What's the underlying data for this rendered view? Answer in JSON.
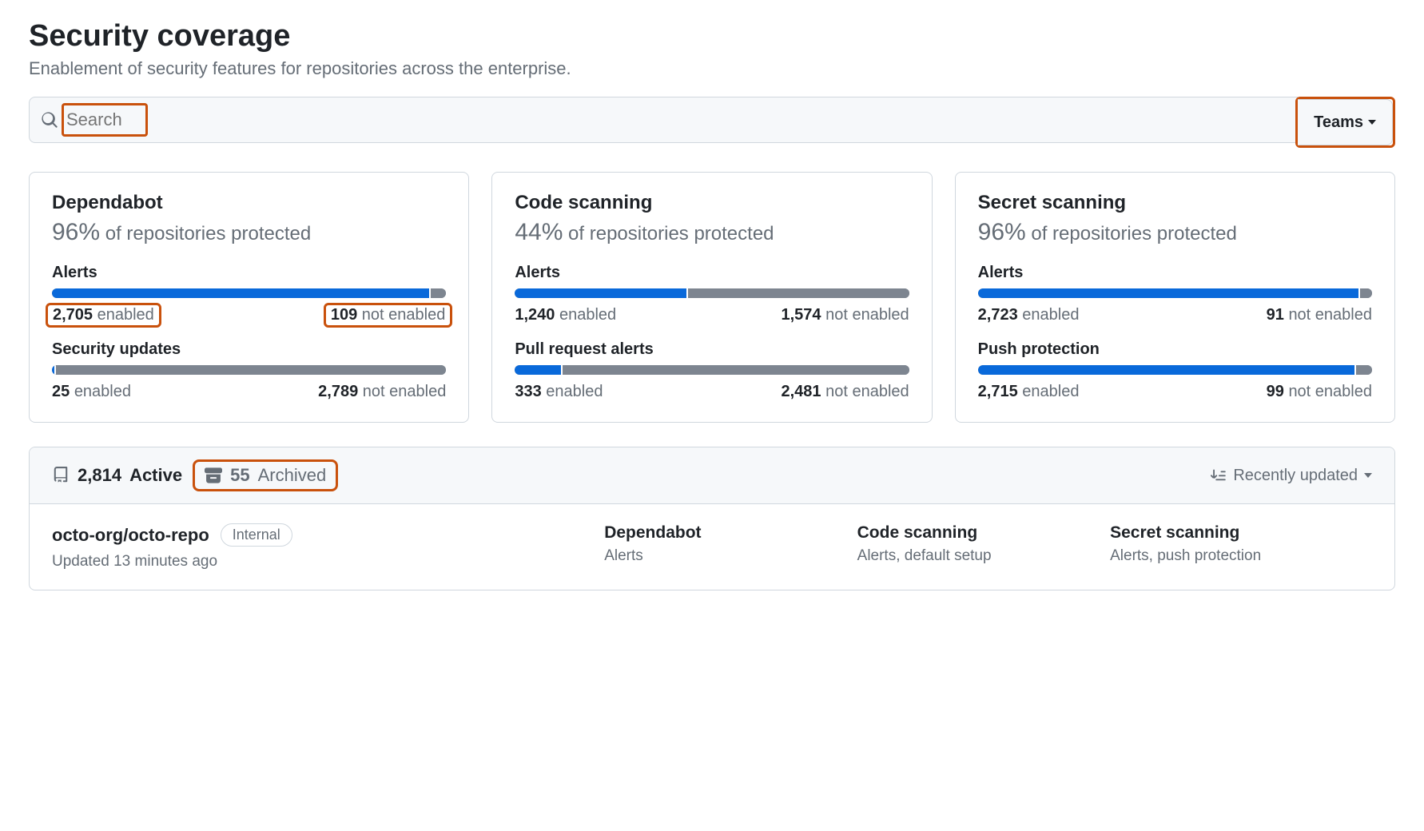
{
  "header": {
    "title": "Security coverage",
    "subtitle": "Enablement of security features for repositories across the enterprise."
  },
  "search": {
    "placeholder": "Search"
  },
  "teams_button": "Teams",
  "cards": {
    "dependabot": {
      "title": "Dependabot",
      "pct": "96%",
      "pct_suffix": "of repositories protected",
      "alerts_label": "Alerts",
      "alerts_enabled": "2,705",
      "alerts_not_enabled": "109",
      "alerts_fill_pct": 96,
      "sec_label": "Security updates",
      "sec_enabled": "25",
      "sec_not_enabled": "2,789",
      "sec_fill_pct": 1
    },
    "code": {
      "title": "Code scanning",
      "pct": "44%",
      "pct_suffix": "of repositories protected",
      "alerts_label": "Alerts",
      "alerts_enabled": "1,240",
      "alerts_not_enabled": "1,574",
      "alerts_fill_pct": 44,
      "pr_label": "Pull request alerts",
      "pr_enabled": "333",
      "pr_not_enabled": "2,481",
      "pr_fill_pct": 12
    },
    "secret": {
      "title": "Secret scanning",
      "pct": "96%",
      "pct_suffix": "of repositories protected",
      "alerts_label": "Alerts",
      "alerts_enabled": "2,723",
      "alerts_not_enabled": "91",
      "alerts_fill_pct": 97,
      "push_label": "Push protection",
      "push_enabled": "2,715",
      "push_not_enabled": "99",
      "push_fill_pct": 96
    }
  },
  "labels": {
    "enabled": "enabled",
    "not_enabled": "not enabled"
  },
  "repos": {
    "active_count": "2,814",
    "active_label": "Active",
    "archived_count": "55",
    "archived_label": "Archived",
    "sort_label": "Recently updated"
  },
  "repo_row": {
    "name": "octo-org/octo-repo",
    "visibility": "Internal",
    "updated": "Updated 13 minutes ago",
    "dependabot_title": "Dependabot",
    "dependabot_sub": "Alerts",
    "code_title": "Code scanning",
    "code_sub": "Alerts, default setup",
    "secret_title": "Secret scanning",
    "secret_sub": "Alerts, push protection"
  }
}
